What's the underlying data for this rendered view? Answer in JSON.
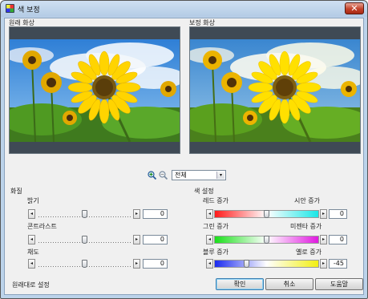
{
  "window": {
    "title": "색 보정",
    "close_glyph": "✕",
    "title_icon": "palette-app-icon",
    "close_icon": "close-icon"
  },
  "preview": {
    "original_label": "원래 화상",
    "corrected_label": "보정 화상"
  },
  "zoom": {
    "zoom_in_icon": "zoom-in-icon",
    "zoom_out_icon": "zoom-out-icon",
    "selected": "전체"
  },
  "tone": {
    "title": "화질",
    "brightness": {
      "label": "밝기",
      "value": "0",
      "level": 0.5
    },
    "contrast": {
      "label": "콘트라스트",
      "value": "0",
      "level": 0.5
    },
    "saturation": {
      "label": "채도",
      "value": "0",
      "level": 0.5
    }
  },
  "color": {
    "title": "색 설정",
    "red": {
      "left": "레드 증가",
      "right": "시안 증가",
      "value": "0",
      "level": 0.5,
      "colors": [
        "#ff1a1a",
        "#ffffff",
        "#1ae6e6"
      ]
    },
    "green": {
      "left": "그린 증가",
      "right": "미젠타 증가",
      "value": "0",
      "level": 0.5,
      "colors": [
        "#1adf1a",
        "#ffffff",
        "#e01ae0"
      ]
    },
    "blue": {
      "left": "블루 증가",
      "right": "옐로 증가",
      "value": "-45",
      "level": 0.3,
      "colors": [
        "#1a2aef",
        "#ffffff",
        "#f2ef12"
      ]
    }
  },
  "arrows": {
    "left": "◂",
    "right": "▸",
    "down": "▾"
  },
  "footer": {
    "reset_label": "원래대로 설정",
    "ok_label": "확인",
    "cancel_label": "취소",
    "help_label": "도움말"
  }
}
